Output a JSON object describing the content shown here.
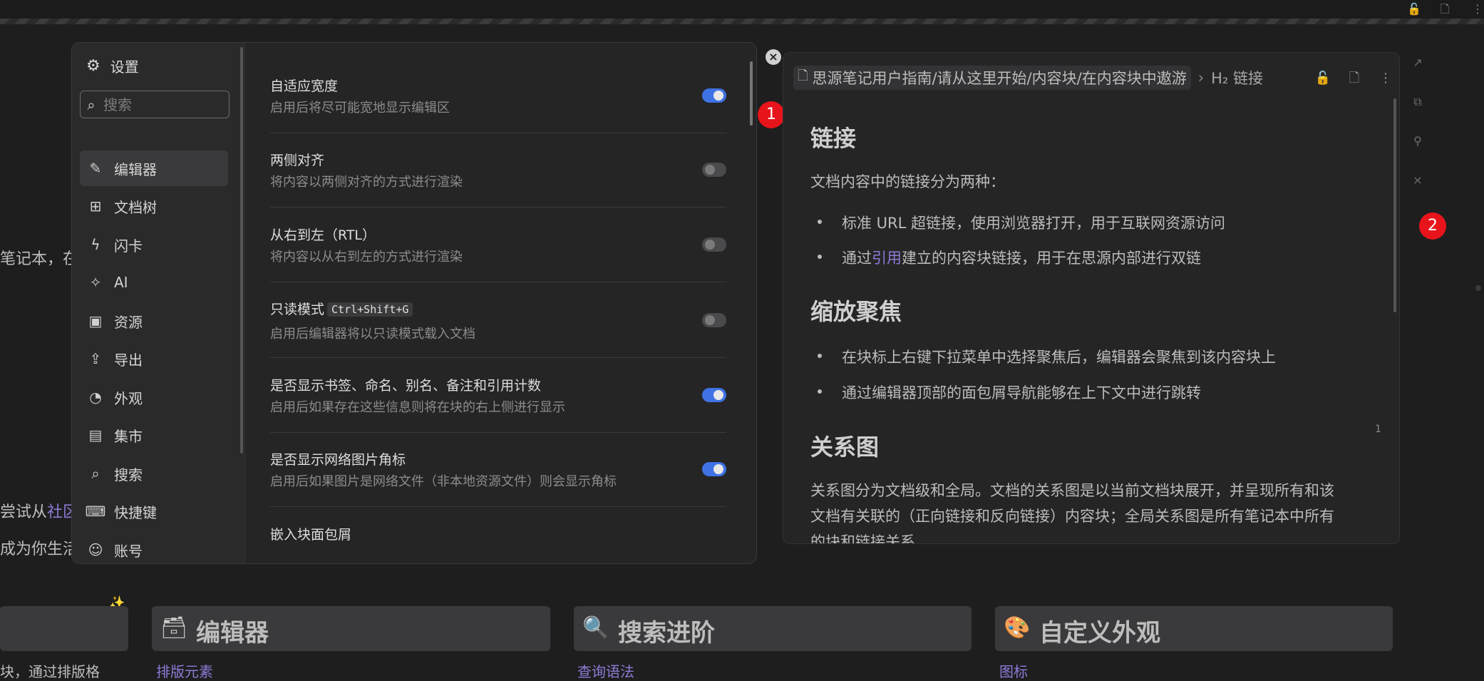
{
  "background": {
    "left_text_1": "笔记本，在",
    "left_text_2_prefix": "尝试从",
    "left_text_2_link": "社区",
    "left_text_3": "成为你生活",
    "sparkle": "✨",
    "cards": [
      {
        "emoji": "📚",
        "title": "",
        "link_prefix": "块，通过排版格"
      },
      {
        "emoji": "🗃",
        "title": "编辑器",
        "link": "排版元素"
      },
      {
        "emoji": "🔍",
        "title": "搜索进阶",
        "link": "查询语法"
      },
      {
        "emoji": "🎨",
        "title": "自定义外观",
        "link": "图标"
      }
    ]
  },
  "settings": {
    "title": "设置",
    "search_placeholder": "搜索",
    "menu": [
      {
        "label": "编辑器",
        "icon": "pencil-icon",
        "active": true
      },
      {
        "label": "文档树",
        "icon": "tree-icon"
      },
      {
        "label": "闪卡",
        "icon": "lightning-icon"
      },
      {
        "label": "AI",
        "icon": "sparkle-icon"
      },
      {
        "label": "资源",
        "icon": "image-icon"
      },
      {
        "label": "导出",
        "icon": "upload-icon"
      },
      {
        "label": "外观",
        "icon": "palette-icon"
      },
      {
        "label": "集市",
        "icon": "store-icon"
      },
      {
        "label": "搜索",
        "icon": "search-icon"
      },
      {
        "label": "快捷键",
        "icon": "keyboard-icon"
      },
      {
        "label": "账号",
        "icon": "user-icon"
      }
    ],
    "options": [
      {
        "label": "自适应宽度",
        "desc": "启用后将尽可能宽地显示编辑区",
        "on": true
      },
      {
        "label": "两侧对齐",
        "desc": "将内容以两侧对齐的方式进行渲染",
        "on": false
      },
      {
        "label": "从右到左（RTL）",
        "desc": "将内容以从右到左的方式进行渲染",
        "on": false
      },
      {
        "label": "只读模式",
        "kbd": "Ctrl+Shift+G",
        "desc": "启用后编辑器将以只读模式载入文档",
        "on": false
      },
      {
        "label": "是否显示书签、命名、别名、备注和引用计数",
        "desc": "启用后如果存在这些信息则将在块的右上侧进行显示",
        "on": true
      },
      {
        "label": "是否显示网络图片角标",
        "desc": "启用后如果图片是网络文件（非本地资源文件）则会显示角标",
        "on": true
      },
      {
        "label": "嵌入块面包屑",
        "desc": ""
      }
    ]
  },
  "badges": {
    "one": "1",
    "two": "2"
  },
  "panel": {
    "breadcrumb_path": "思源笔记用户指南/请从这里开始/内容块/在内容块中遨游",
    "breadcrumb_current": "H₂ 链接",
    "h2_links": "链接",
    "p_links": "文档内容中的链接分为两种：",
    "li_1": "标准 URL 超链接，使用浏览器打开，用于互联网资源访问",
    "li_2_prefix": "通过",
    "li_2_link": "引用",
    "li_2_suffix": "建立的内容块链接，用于在思源内部进行双链",
    "h2_zoom": "缩放聚焦",
    "li_3": "在块标上右键下拉菜单中选择聚焦后，编辑器会聚焦到该内容块上",
    "li_4": "通过编辑器顶部的面包屑导航能够在上下文中进行跳转",
    "h2_graph": "关系图",
    "p_graph_1": "关系图分为文档级和全局。文档的关系图是以当前文档块展开，并呈现所有和该",
    "p_graph_2": "文档有关联的（正向链接和反向链接）内容块；全局关系图是所有笔记本中所有",
    "p_graph_3": "的块和链接关系。",
    "counter": "1"
  }
}
